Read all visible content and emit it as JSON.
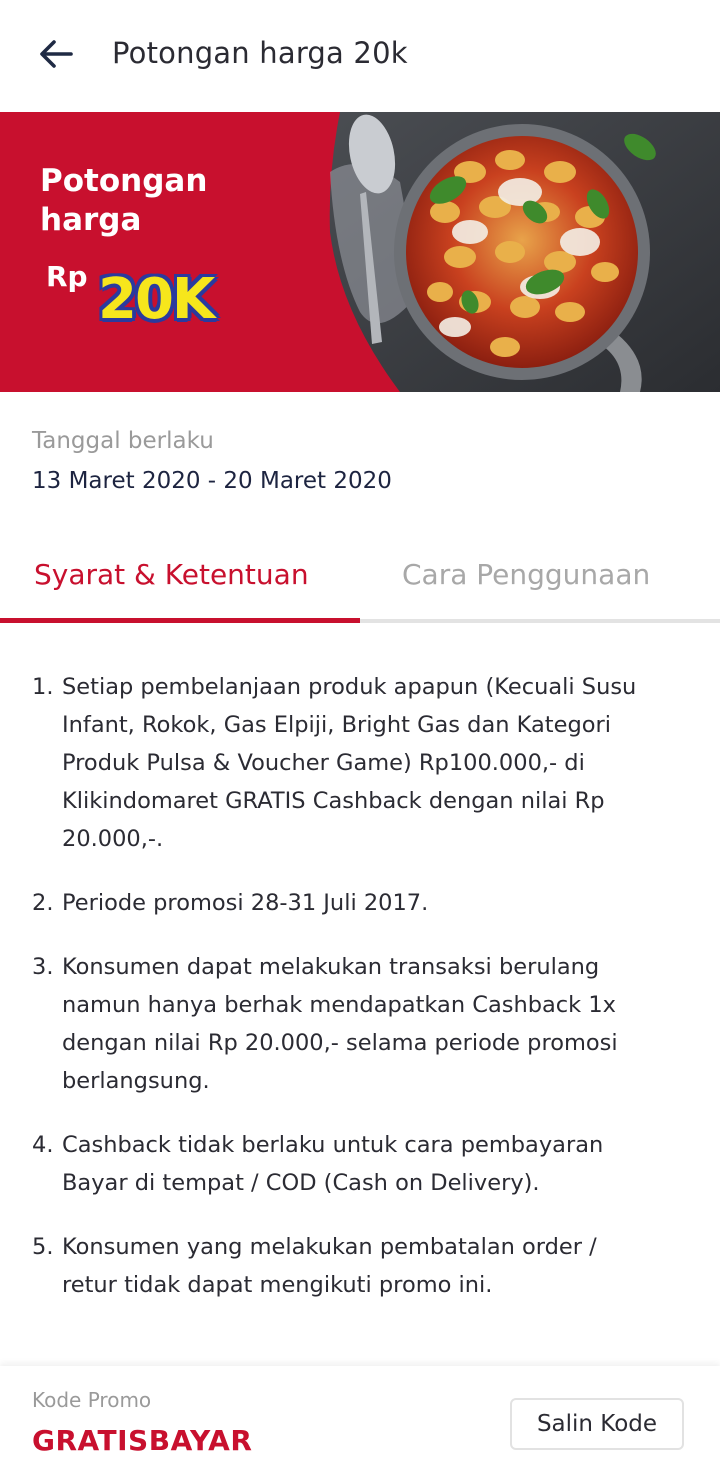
{
  "header": {
    "title": "Potongan harga 20k",
    "back_icon": "arrow-left-icon"
  },
  "banner": {
    "title": "Potongan harga",
    "currency": "Rp",
    "amount": "20K",
    "image_subject": "baked gnocchi with tomato sauce and basil in a pan",
    "colors": {
      "background": "#c8102e",
      "amount_fill": "#f6e61c",
      "amount_outline": "#2a3a9e"
    }
  },
  "validity": {
    "label": "Tanggal berlaku",
    "value": "13 Maret 2020 - 20 Maret 2020"
  },
  "tabs": [
    {
      "label": "Syarat & Ketentuan",
      "active": true
    },
    {
      "label": "Cara Penggunaan",
      "active": false
    }
  ],
  "terms": [
    {
      "number": "1.",
      "text": "Setiap pembelanjaan produk apapun (Kecuali Susu Infant, Rokok, Gas Elpiji, Bright Gas dan Kategori Produk Pulsa & Voucher Game) Rp100.000,- di Klikindomaret GRATIS Cashback dengan nilai Rp 20.000,-."
    },
    {
      "number": "2.",
      "text": "Periode promosi 28-31 Juli 2017."
    },
    {
      "number": "3.",
      "text": "Konsumen dapat melakukan transaksi berulang namun hanya berhak mendapatkan Cashback 1x dengan nilai Rp 20.000,- selama periode promosi berlangsung."
    },
    {
      "number": "4.",
      "text": "Cashback tidak berlaku untuk cara pembayaran Bayar di tempat / COD (Cash on Delivery)."
    },
    {
      "number": "5.",
      "text": "Konsumen yang melakukan pembatalan order / retur tidak dapat mengikuti promo ini."
    }
  ],
  "promo": {
    "label": "Kode Promo",
    "code": "GRATISBAYAR",
    "copy_label": "Salin Kode"
  },
  "colors": {
    "accent": "#c8102e",
    "text_primary": "#2b2b33",
    "text_secondary": "#9a9a9a"
  }
}
